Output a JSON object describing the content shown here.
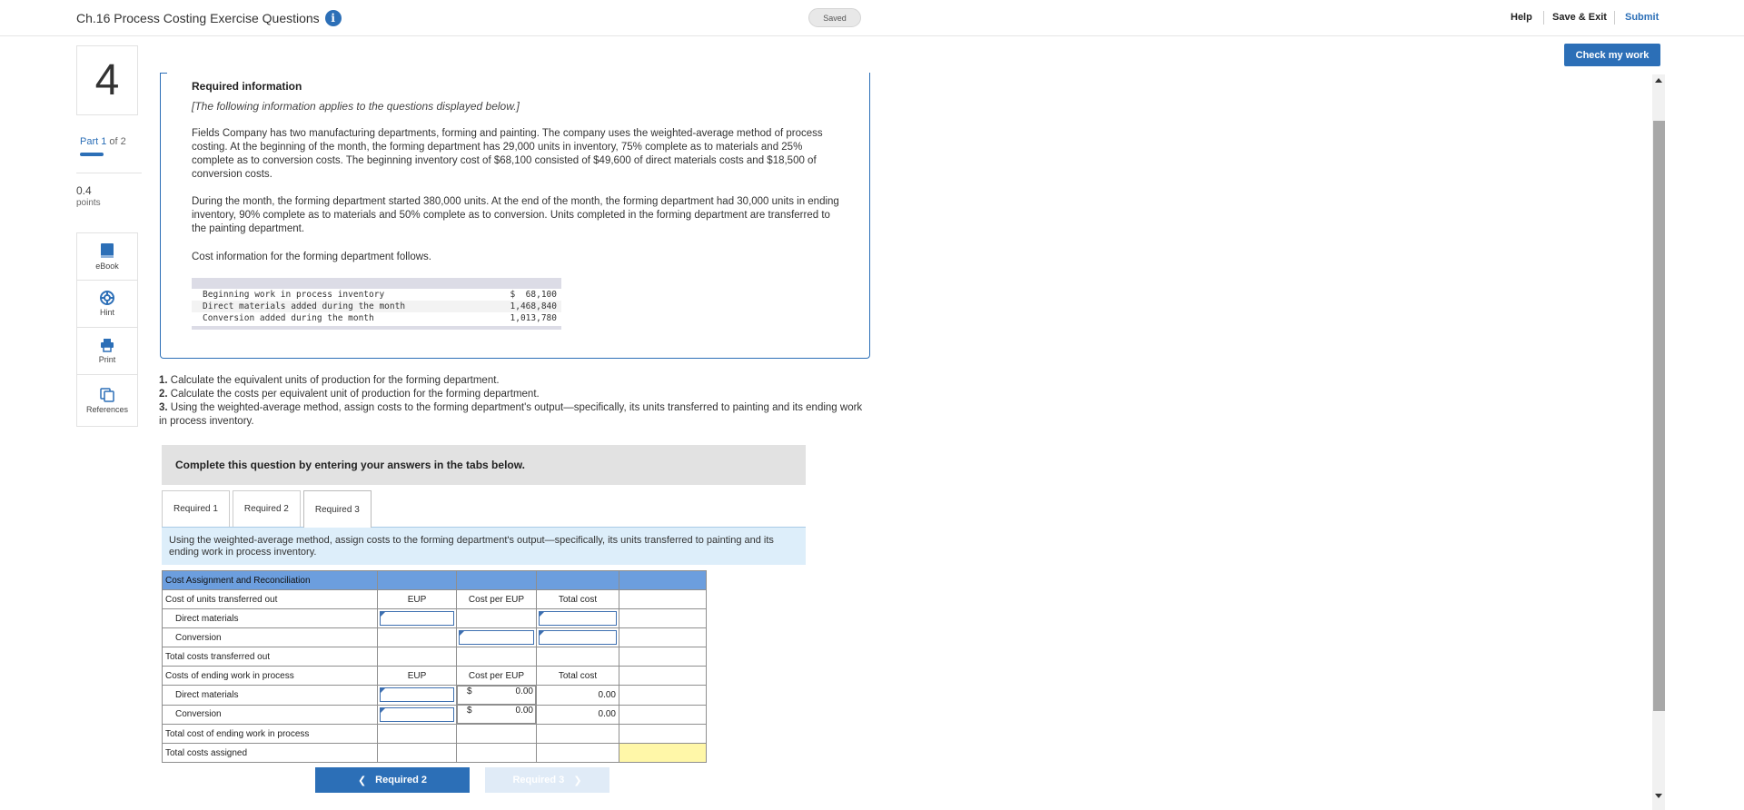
{
  "header": {
    "title": "Ch.16 Process Costing Exercise Questions",
    "saved": "Saved",
    "help": "Help",
    "save_exit": "Save & Exit",
    "submit": "Submit",
    "check_work": "Check my work"
  },
  "rail": {
    "question_number": "4",
    "part_current": "Part 1",
    "part_total": " of 2",
    "points_value": "0.4",
    "points_label": "points",
    "tools": [
      {
        "label": "eBook",
        "icon": "book-icon"
      },
      {
        "label": "Hint",
        "icon": "lifebuoy-icon"
      },
      {
        "label": "Print",
        "icon": "printer-icon"
      },
      {
        "label": "References",
        "icon": "copy-icon"
      }
    ]
  },
  "info": {
    "title": "Required information",
    "note": "[The following information applies to the questions displayed below.]",
    "p1": "Fields Company has two manufacturing departments, forming and painting. The company uses the weighted-average method of process costing. At the beginning of the month, the forming department has 29,000 units in inventory, 75% complete as to materials and 25% complete as to conversion costs. The beginning inventory cost of $68,100 consisted of $49,600 of direct materials costs and $18,500 of conversion costs.",
    "p2": "During the month, the forming department started 380,000 units. At the end of the month, the forming department had 30,000 units in ending inventory, 90% complete as to materials and 50% complete as to conversion. Units completed in the forming department are transferred to the painting department.",
    "p3": "Cost information for the forming department follows.",
    "costs": [
      {
        "label": "Beginning work in process inventory",
        "value": "$  68,100"
      },
      {
        "label": "Direct materials added during the month",
        "value": "1,468,840"
      },
      {
        "label": "Conversion added during the month",
        "value": "1,013,780"
      }
    ]
  },
  "questions": {
    "q1_num": "1.",
    "q1": " Calculate the equivalent units of production for the forming department.",
    "q2_num": "2.",
    "q2": " Calculate the costs per equivalent unit of production for the forming department.",
    "q3_num": "3.",
    "q3": " Using the weighted-average method, assign costs to the forming department's output—specifically, its units transferred to painting and its ending work in process inventory."
  },
  "complete_bar": "Complete this question by entering your answers in the tabs below.",
  "tabs": [
    "Required 1",
    "Required 2",
    "Required 3"
  ],
  "panel_desc": "Using the weighted-average method, assign costs to the forming department's output—specifically, its units transferred to painting and its ending work in process inventory.",
  "table": {
    "header": "Cost Assignment and Reconciliation",
    "transferred_label": "Cost of units transferred out",
    "col_eup": "EUP",
    "col_cost_per_eup": "Cost per EUP",
    "col_total_cost": "Total cost",
    "direct_materials": "Direct materials",
    "conversion": "Conversion",
    "total_transferred": "Total costs transferred out",
    "ending_label": "Costs of ending work in process",
    "dollar": "$",
    "zero": "0.00",
    "total_ending": "Total cost of ending work in process",
    "total_assigned": "Total costs assigned"
  },
  "nav": {
    "prev": "Required 2",
    "next": "Required 3"
  }
}
